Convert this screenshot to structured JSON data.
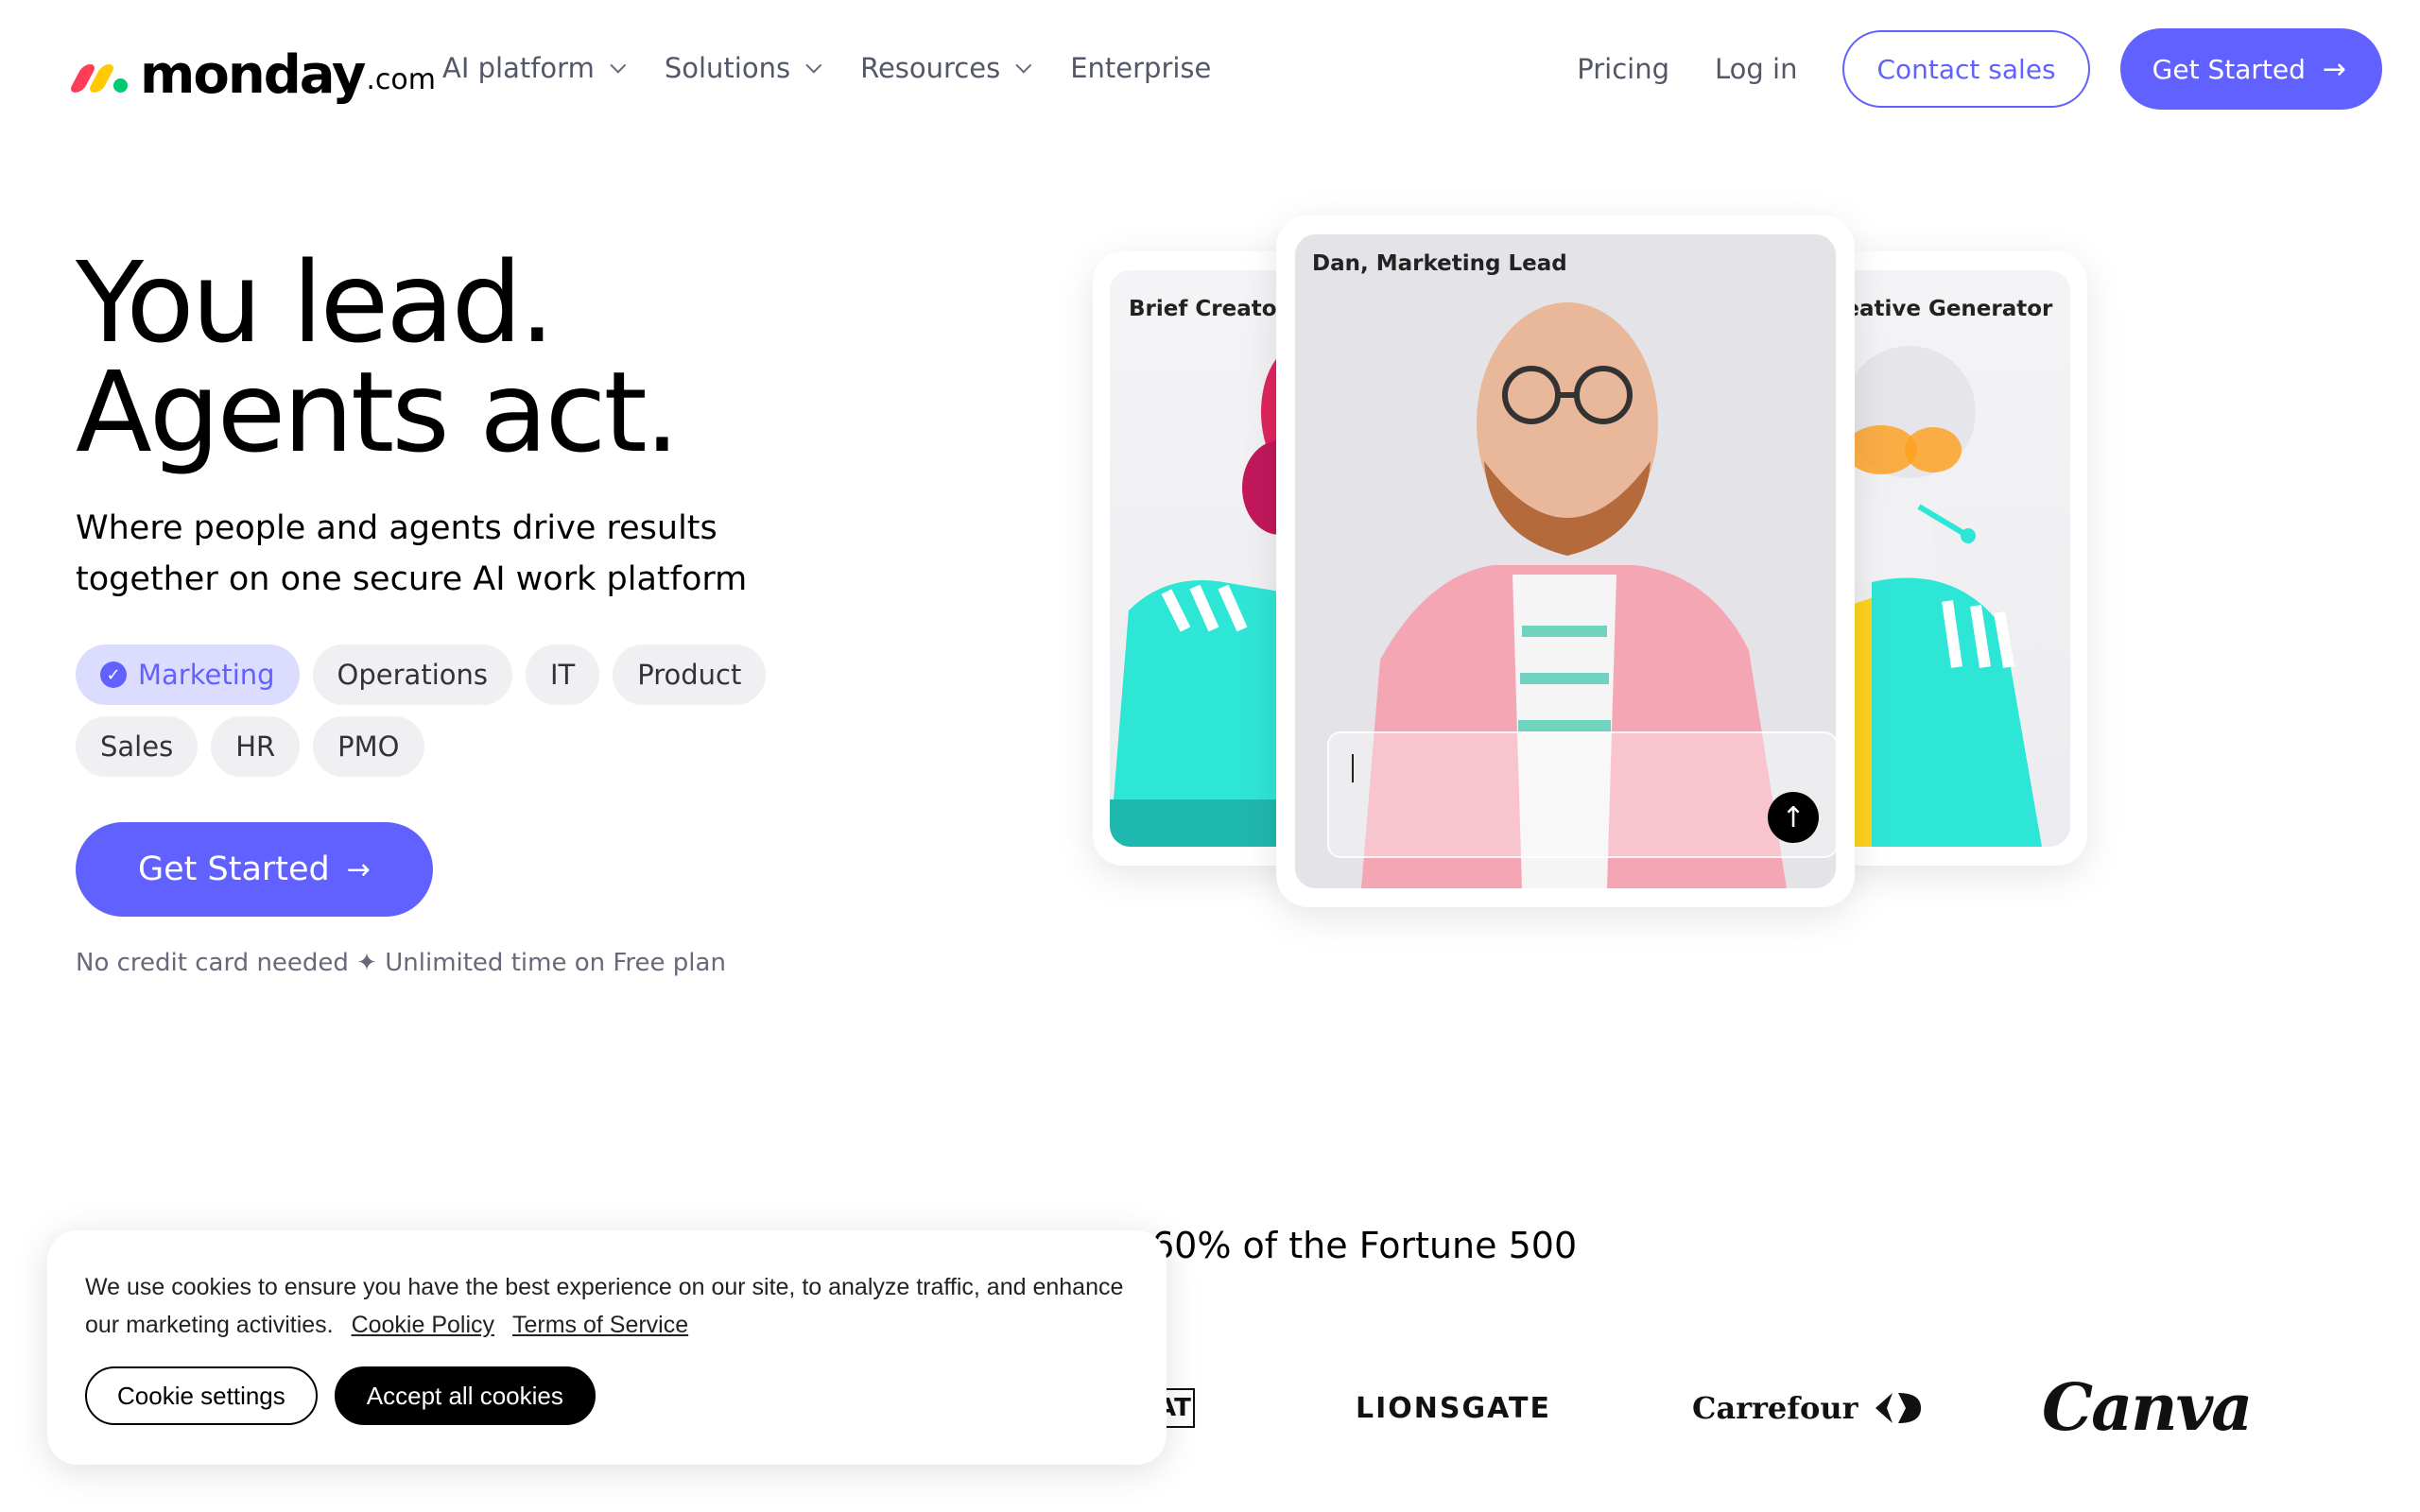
{
  "header": {
    "logo": {
      "word": "monday",
      "suffix": ".com",
      "colors": [
        "#ff3d57",
        "#ffcb00",
        "#00ca72"
      ]
    },
    "nav": [
      {
        "label": "AI platform",
        "has_dropdown": true
      },
      {
        "label": "Solutions",
        "has_dropdown": true
      },
      {
        "label": "Resources",
        "has_dropdown": true
      },
      {
        "label": "Enterprise",
        "has_dropdown": false
      }
    ],
    "pricing": "Pricing",
    "login": "Log in",
    "contact_sales": "Contact sales",
    "get_started": "Get Started"
  },
  "hero": {
    "title_line1": "You lead.",
    "title_line2": "Agents act.",
    "subtitle": "Where people and agents drive results together on one secure AI work platform",
    "chips_row1": [
      {
        "label": "Marketing",
        "selected": true
      },
      {
        "label": "Operations",
        "selected": false
      },
      {
        "label": "IT",
        "selected": false
      },
      {
        "label": "Product",
        "selected": false
      }
    ],
    "chips_row2": [
      {
        "label": "Sales",
        "selected": false
      },
      {
        "label": "HR",
        "selected": false
      },
      {
        "label": "PMO",
        "selected": false
      }
    ],
    "cta": "Get Started",
    "note": "No credit card needed  ✦  Unlimited time on Free plan"
  },
  "visual": {
    "left_card_label": "Brief Creator",
    "center_card_label": "Dan, Marketing Lead",
    "right_card_label": "reative Generator",
    "send_icon": "arrow-up-icon"
  },
  "trust": {
    "headline": "60% of the Fortune 500",
    "logos": [
      "AT",
      "LIONSGATE",
      "Carrefour",
      "Canva"
    ]
  },
  "cookie": {
    "text": "We use cookies to ensure you have the best experience on our site, to analyze traffic, and enhance our marketing activities.",
    "policy_link": "Cookie Policy",
    "terms_link": "Terms of Service",
    "settings_button": "Cookie settings",
    "accept_button": "Accept all cookies"
  },
  "colors": {
    "brand_primary": "#6161ff",
    "chip_bg": "#f0f0f3",
    "chip_active_bg": "#dcdcff"
  }
}
